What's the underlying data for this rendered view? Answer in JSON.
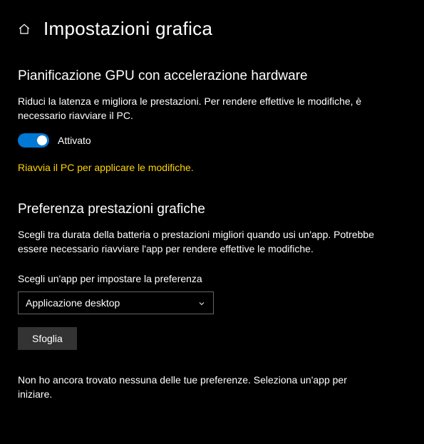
{
  "header": {
    "title": "Impostazioni grafica"
  },
  "gpu_section": {
    "heading": "Pianificazione GPU con accelerazione hardware",
    "description": "Riduci la latenza e migliora le prestazioni. Per rendere effettive le modifiche, è necessario riavviare il PC.",
    "toggle_state": "Attivato",
    "warning": "Riavvia il PC per applicare le modifiche."
  },
  "pref_section": {
    "heading": "Preferenza prestazioni grafiche",
    "description": "Scegli tra durata della batteria o prestazioni migliori quando usi un'app. Potrebbe essere necessario riavviare l'app per rendere effettive le modifiche.",
    "select_label": "Scegli un'app per impostare la preferenza",
    "select_value": "Applicazione desktop",
    "browse_button": "Sfoglia",
    "empty_state": "Non ho ancora trovato nessuna delle tue preferenze. Seleziona un'app per iniziare."
  }
}
